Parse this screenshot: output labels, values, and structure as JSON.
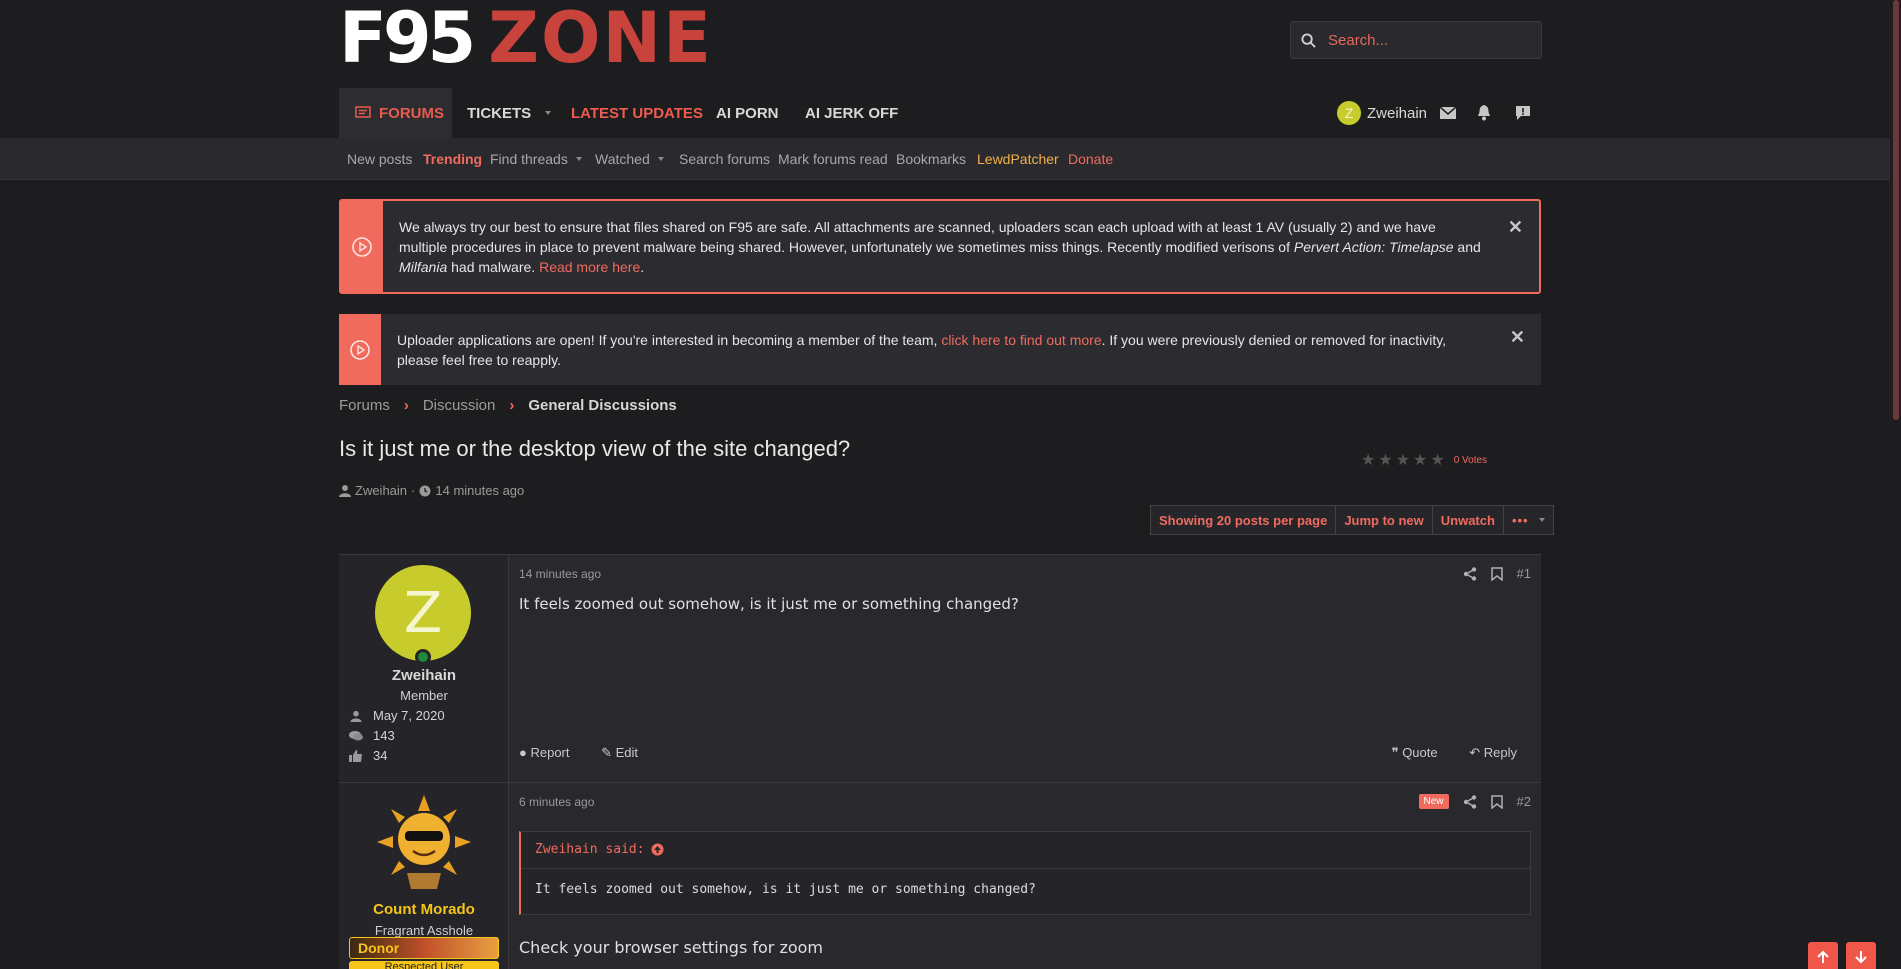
{
  "logo": {
    "part1": "F95",
    "part2": "ZONE"
  },
  "search": {
    "placeholder": "Search..."
  },
  "nav": {
    "tabs": [
      {
        "label": "FORUMS"
      },
      {
        "label": "TICKETS"
      },
      {
        "label": "LATEST UPDATES"
      },
      {
        "label": "AI PORN"
      },
      {
        "label": "AI JERK OFF"
      }
    ],
    "user": {
      "initial": "Z",
      "name": "Zweihain"
    }
  },
  "subnav": {
    "items": [
      {
        "label": "New posts"
      },
      {
        "label": "Trending"
      },
      {
        "label": "Find threads"
      },
      {
        "label": "Watched"
      },
      {
        "label": "Search forums"
      },
      {
        "label": "Mark forums read"
      },
      {
        "label": "Bookmarks"
      },
      {
        "label": "LewdPatcher"
      },
      {
        "label": "Donate"
      }
    ]
  },
  "notices": [
    {
      "text_a": "We always try our best to ensure that files shared on F95 are safe. All attachments are scanned, uploaders scan each upload with at least 1 AV (usually 2) and we have multiple procedures in place to prevent malware being shared. However, unfortunately we sometimes miss things. Recently modified verisons of ",
      "em1": "Pervert Action: Timelapse",
      "text_b": " and ",
      "em2": "Milfania",
      "text_c": " had malware. ",
      "link": "Read more here",
      "text_d": "."
    },
    {
      "text_a": "Uploader applications are open! If you're interested in becoming a member of the team, ",
      "link": "click here to find out more",
      "text_b": ". If you were previously denied or removed for inactivity, please feel free to reapply."
    }
  ],
  "breadcrumb": [
    "Forums",
    "Discussion",
    "General Discussions"
  ],
  "thread": {
    "title": "Is it just me or the desktop view of the site changed?",
    "author": "Zweihain",
    "time": "14 minutes ago",
    "votes": "0 Votes"
  },
  "page_buttons": [
    "Showing 20 posts per page",
    "Jump to new",
    "Unwatch",
    "•••"
  ],
  "posts": [
    {
      "user": {
        "initial": "Z",
        "name": "Zweihain",
        "title": "Member",
        "joined": "May 7, 2020",
        "messages": "143",
        "reactions": "34"
      },
      "date": "14 minutes ago",
      "number": "#1",
      "text": "It feels zoomed out somehow, is it just me or something changed?",
      "actions": {
        "report": "Report",
        "edit": "Edit",
        "quote": "Quote",
        "reply": "Reply"
      }
    },
    {
      "user": {
        "name": "Count Morado",
        "title": "Fragrant Asshole",
        "banner": "Donor",
        "banner2": "Respected User"
      },
      "date": "6 minutes ago",
      "badge": "New",
      "number": "#2",
      "quote_header": "Zweihain said:",
      "quote_text": "It feels zoomed out somehow, is it just me or something changed?",
      "text": "Check your browser settings for zoom"
    }
  ],
  "colors": {
    "accent": "#f06b5e",
    "background": "#1d1d20",
    "panel": "#29292d",
    "avatar_z": "#c7cc2c",
    "gold": "#f5c518"
  }
}
